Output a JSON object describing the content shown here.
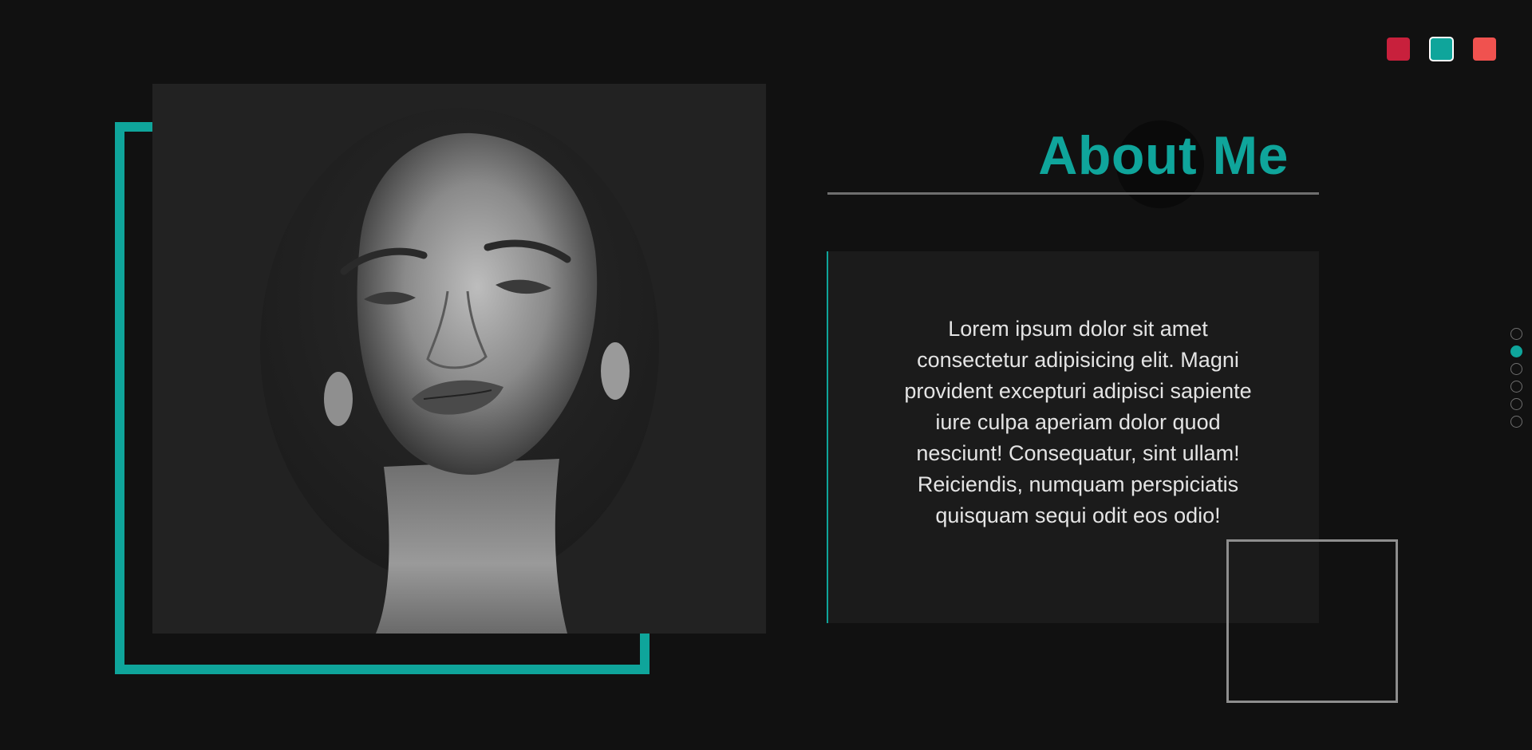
{
  "theme": {
    "accent": "#0fa59b",
    "background": "#111111",
    "swatches": [
      {
        "name": "crimson",
        "color": "#c8203c",
        "active": false
      },
      {
        "name": "teal",
        "color": "#0fa59b",
        "active": true
      },
      {
        "name": "coral",
        "color": "#f0524f",
        "active": false
      }
    ]
  },
  "about": {
    "title": "About Me",
    "body": "Lorem ipsum dolor sit amet consectetur adipisicing elit. Magni provident excepturi adipisci sapiente iure culpa aperiam dolor quod nesciunt! Consequatur, sint ullam! Reiciendis, numquam perspiciatis quisquam sequi odit eos odio!"
  },
  "nav": {
    "dots": [
      {
        "active": false
      },
      {
        "active": true
      },
      {
        "active": false
      },
      {
        "active": false
      },
      {
        "active": false
      },
      {
        "active": false
      }
    ]
  }
}
